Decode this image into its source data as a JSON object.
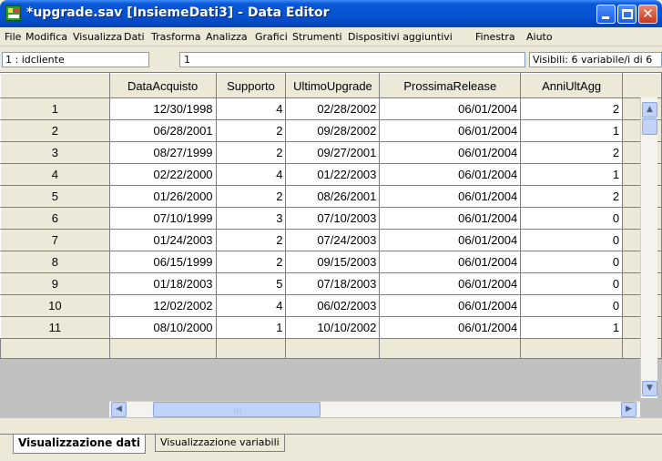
{
  "window": {
    "title": "*upgrade.sav [InsiemeDati3] - Data Editor"
  },
  "menu": [
    "File",
    "Modifica",
    "Visualizza",
    "Dati",
    "Trasforma",
    "Analizza",
    "Grafici",
    "Strumenti",
    "Dispositivi aggiuntivi",
    "Finestra",
    "Aiuto"
  ],
  "cellbar": {
    "ref": "1 : idcliente",
    "value": "1",
    "visible": "Visibili: 6 variabile/i di 6"
  },
  "grid": {
    "columns": [
      "DataAcquisto",
      "Supporto",
      "UltimoUpgrade",
      "ProssimaRelease",
      "AnniUltAgg"
    ],
    "rows": [
      {
        "n": "1",
        "cells": [
          "12/30/1998",
          "4",
          "02/28/2002",
          "06/01/2004",
          "2"
        ]
      },
      {
        "n": "2",
        "cells": [
          "06/28/2001",
          "2",
          "09/28/2002",
          "06/01/2004",
          "1"
        ]
      },
      {
        "n": "3",
        "cells": [
          "08/27/1999",
          "2",
          "09/27/2001",
          "06/01/2004",
          "2"
        ]
      },
      {
        "n": "4",
        "cells": [
          "02/22/2000",
          "4",
          "01/22/2003",
          "06/01/2004",
          "1"
        ]
      },
      {
        "n": "5",
        "cells": [
          "01/26/2000",
          "2",
          "08/26/2001",
          "06/01/2004",
          "2"
        ]
      },
      {
        "n": "6",
        "cells": [
          "07/10/1999",
          "3",
          "07/10/2003",
          "06/01/2004",
          "0"
        ]
      },
      {
        "n": "7",
        "cells": [
          "01/24/2003",
          "2",
          "07/24/2003",
          "06/01/2004",
          "0"
        ]
      },
      {
        "n": "8",
        "cells": [
          "06/15/1999",
          "2",
          "09/15/2003",
          "06/01/2004",
          "0"
        ]
      },
      {
        "n": "9",
        "cells": [
          "01/18/2003",
          "5",
          "07/18/2003",
          "06/01/2004",
          "0"
        ]
      },
      {
        "n": "10",
        "cells": [
          "12/02/2002",
          "4",
          "06/02/2003",
          "06/01/2004",
          "0"
        ]
      },
      {
        "n": "11",
        "cells": [
          "08/10/2000",
          "1",
          "10/10/2002",
          "06/01/2004",
          "1"
        ]
      }
    ]
  },
  "tabs": {
    "data_view": "Visualizzazione dati",
    "variable_view": "Visualizzazione variabili"
  },
  "icons": {
    "app": "spss-grid-icon",
    "minimize": "minimize-icon",
    "maximize": "maximize-icon",
    "close": "close-icon",
    "scroll_up": "chevron-up-icon",
    "scroll_down": "chevron-down-icon",
    "scroll_left": "chevron-left-icon",
    "scroll_right": "chevron-right-icon"
  },
  "colors": {
    "titlebar": "#0553d2",
    "chrome": "#ece9d8",
    "grid_bg": "#c0c0c0",
    "close_button": "#c7391b"
  }
}
